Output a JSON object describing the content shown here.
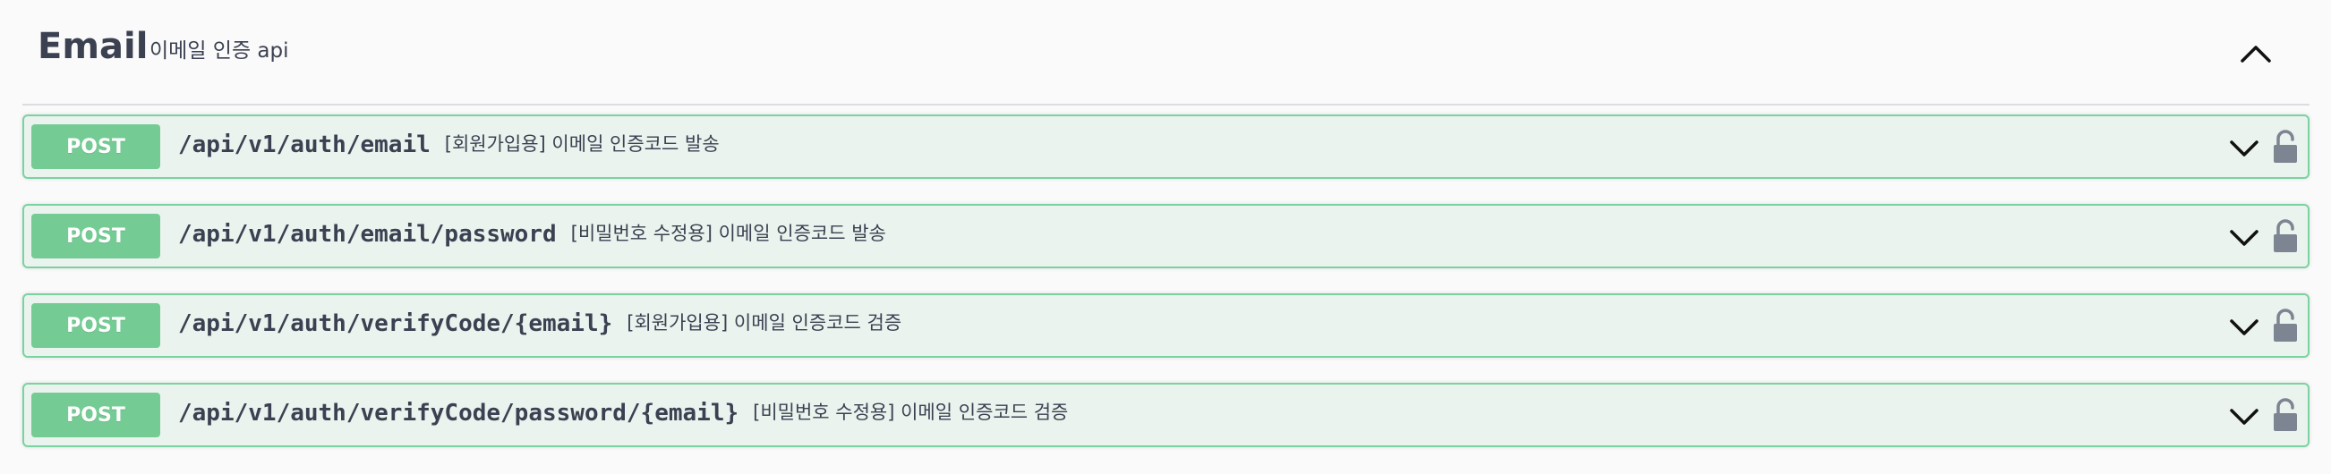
{
  "section": {
    "title": "Email",
    "description": "이메일 인증 api"
  },
  "operations": [
    {
      "method": "POST",
      "path": "/api/v1/auth/email",
      "summary": "[회원가입용] 이메일 인증코드 발송"
    },
    {
      "method": "POST",
      "path": "/api/v1/auth/email/password",
      "summary": "[비밀번호 수정용] 이메일 인증코드 발송"
    },
    {
      "method": "POST",
      "path": "/api/v1/auth/verifyCode/{email}",
      "summary": "[회원가입용] 이메일 인증코드 검증"
    },
    {
      "method": "POST",
      "path": "/api/v1/auth/verifyCode/password/{email}",
      "summary": "[비밀번호 수정용] 이메일 인증코드 검증"
    }
  ],
  "icons": {
    "collapse": "chevron-up-icon",
    "expand": "chevron-down-icon",
    "auth": "unlocked-padlock-icon"
  },
  "colors": {
    "post_method": "#74cc94",
    "post_background": "#ebf3ee",
    "post_border": "#79d3a0",
    "text": "#3b4151"
  }
}
